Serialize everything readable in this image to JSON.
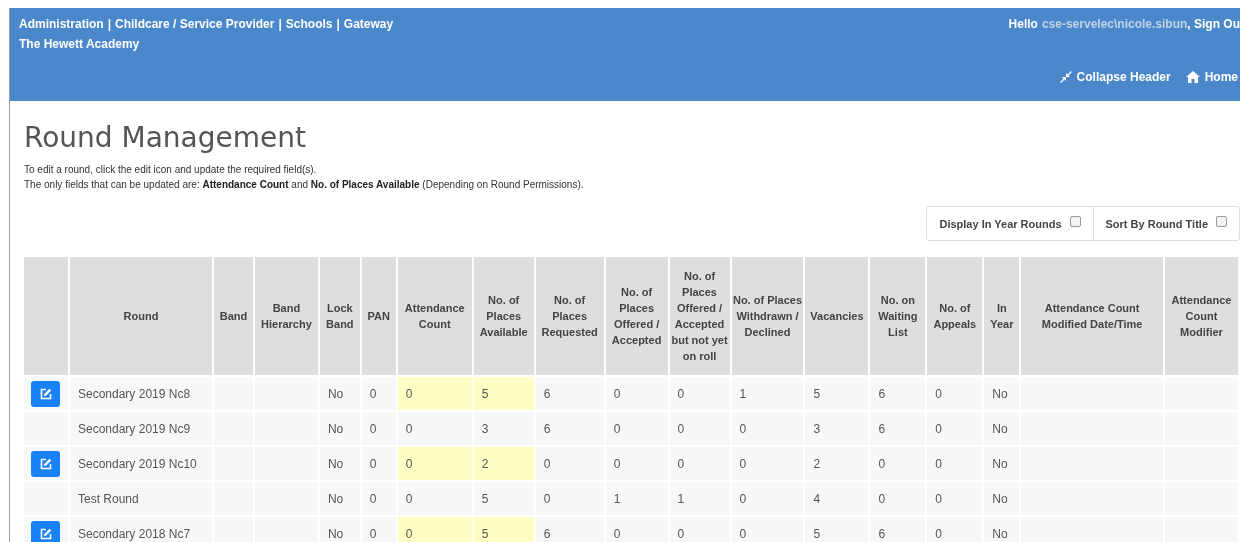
{
  "header": {
    "nav_links": [
      "Administration",
      "Childcare / Service Provider",
      "Schools",
      "Gateway"
    ],
    "separator": "|",
    "organisation": "The Hewett Academy",
    "greeting": "Hello",
    "user": "cse-servelec\\nicole.sibun",
    "sign_out": ", Sign Ou",
    "actions": [
      {
        "kind": "collapse",
        "label": "Collapse Header"
      },
      {
        "kind": "home",
        "label": "Home"
      }
    ]
  },
  "page": {
    "title": "Round Management",
    "instructions": [
      "To edit a round, click the edit icon and update the required field(s).",
      "The only fields that can be updated are: **Attendance Count** and **No. of Places Available** (Depending on Round Permissions)."
    ]
  },
  "filters": [
    {
      "label": "Display In Year Rounds",
      "checked": false
    },
    {
      "label": "Sort By Round Title",
      "checked": false
    }
  ],
  "table": {
    "columns": [
      "Round",
      "Band",
      "Band Hierarchy",
      "Lock Band",
      "PAN",
      "Attendance Count",
      "No. of Places Available",
      "No. of Places Requested",
      "No. of Places Offered / Accepted",
      "No. of Places Offered / Accepted but not yet on roll",
      "No. of Places Withdrawn / Declined",
      "Vacancies",
      "No. on Waiting List",
      "No. of Appeals",
      "In Year",
      "Attendance Count Modified Date/Time",
      "Attendance Count Modifier"
    ],
    "rows": [
      {
        "editable": true,
        "cells": [
          "Secondary 2019 Nc8",
          null,
          null,
          "No",
          "0",
          "0",
          "5",
          "6",
          "0",
          "0",
          "1",
          "5",
          "6",
          "0",
          "No",
          null,
          null
        ]
      },
      {
        "editable": false,
        "cells": [
          "Secondary 2019 Nc9",
          null,
          null,
          "No",
          "0",
          "0",
          "3",
          "6",
          "0",
          "0",
          "0",
          "3",
          "6",
          "0",
          "No",
          null,
          null
        ]
      },
      {
        "editable": true,
        "cells": [
          "Secondary 2019 Nc10",
          null,
          null,
          "No",
          "0",
          "0",
          "2",
          "0",
          "0",
          "0",
          "0",
          "2",
          "0",
          "0",
          "No",
          null,
          null
        ]
      },
      {
        "editable": false,
        "cells": [
          "Test Round",
          null,
          null,
          "No",
          "0",
          "0",
          "5",
          "0",
          "1",
          "1",
          "0",
          "4",
          "0",
          "0",
          "No",
          null,
          null
        ]
      },
      {
        "editable": true,
        "cells": [
          "Secondary 2018 Nc7",
          null,
          null,
          "No",
          "0",
          "0",
          "5",
          "6",
          "0",
          "0",
          "0",
          "5",
          "6",
          "0",
          "No",
          null,
          null
        ]
      }
    ]
  }
}
